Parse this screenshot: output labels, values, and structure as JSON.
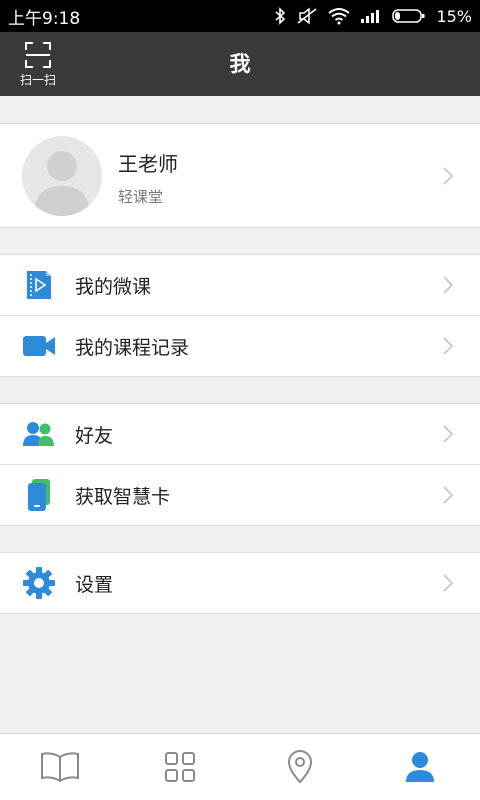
{
  "status_bar": {
    "time": "上午9:18",
    "battery": "15%",
    "icons": [
      "bluetooth-icon",
      "mute-icon",
      "wifi-icon",
      "signal-icon",
      "battery-icon"
    ]
  },
  "nav": {
    "scan_label": "扫一扫",
    "title": "我"
  },
  "profile": {
    "name": "王老师",
    "subtitle": "轻课堂"
  },
  "groups": [
    {
      "items": [
        {
          "label": "我的微课",
          "icon": "video-file-icon"
        },
        {
          "label": "我的课程记录",
          "icon": "camera-icon"
        }
      ]
    },
    {
      "items": [
        {
          "label": "好友",
          "icon": "friends-icon"
        },
        {
          "label": "获取智慧卡",
          "icon": "card-icon"
        }
      ]
    },
    {
      "items": [
        {
          "label": "设置",
          "icon": "gear-icon"
        }
      ]
    }
  ],
  "tabs": [
    {
      "icon": "book-icon",
      "active": false
    },
    {
      "icon": "grid-icon",
      "active": false
    },
    {
      "icon": "location-icon",
      "active": false
    },
    {
      "icon": "user-icon",
      "active": true
    }
  ],
  "colors": {
    "accent": "#2d8bd9",
    "nav_bg": "#3a3a3a",
    "page_bg": "#efeff4",
    "friend_green": "#3fbf6a",
    "card_green": "#3fbf6a"
  }
}
